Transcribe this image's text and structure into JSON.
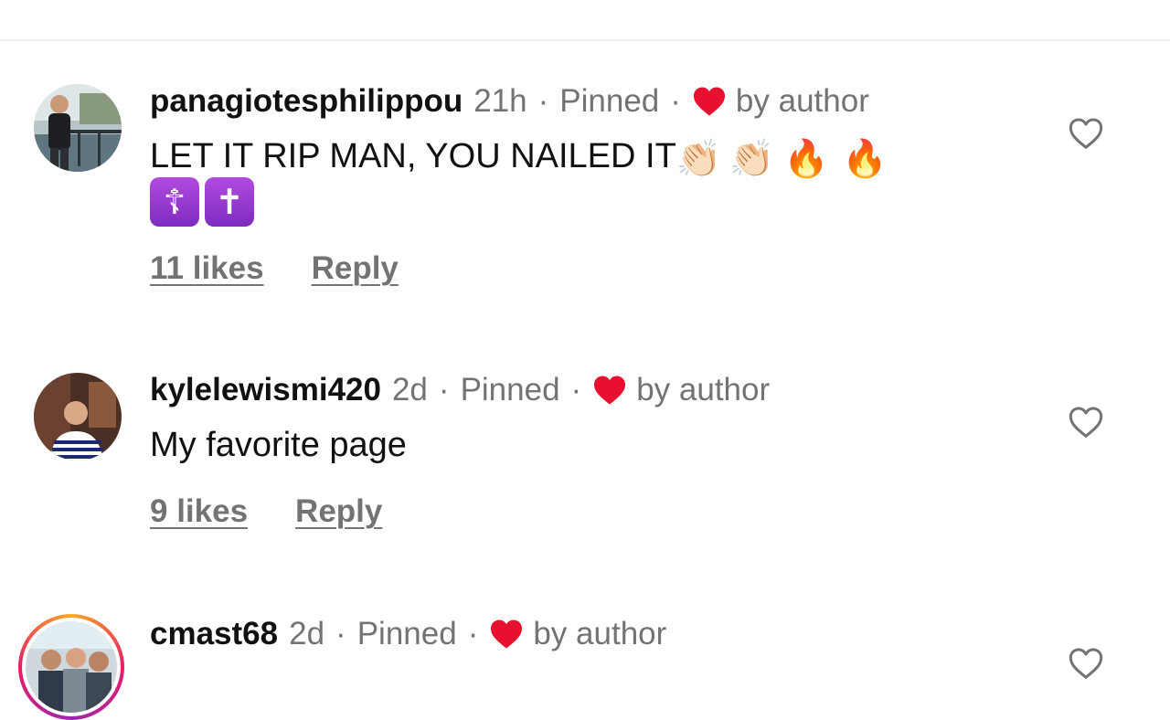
{
  "comments": [
    {
      "username": "panagiotesphilippou",
      "time": "21h",
      "pinned": "Pinned",
      "by_author": "by author",
      "text": "LET IT RIP MAN, YOU NAILED IT",
      "emoji_line1": [
        "👏🏻",
        "👏🏻",
        "🔥",
        "🔥"
      ],
      "emoji_line2": [
        "☦",
        "✝"
      ],
      "likes": "11 likes",
      "reply": "Reply"
    },
    {
      "username": "kylelewismi420",
      "time": "2d",
      "pinned": "Pinned",
      "by_author": "by author",
      "text": "My favorite page",
      "likes": "9 likes",
      "reply": "Reply"
    },
    {
      "username": "cmast68",
      "time": "2d",
      "pinned": "Pinned",
      "by_author": "by author"
    }
  ],
  "meta_separator": "·",
  "icons": {
    "author_heart": "heart-filled-icon",
    "like_button": "heart-outline-icon"
  },
  "colors": {
    "author_heart": "#e8102f",
    "muted_text": "#737373",
    "divider": "#ececec",
    "story_ring_start": "#f9a825",
    "story_ring_end": "#9c27b0"
  }
}
